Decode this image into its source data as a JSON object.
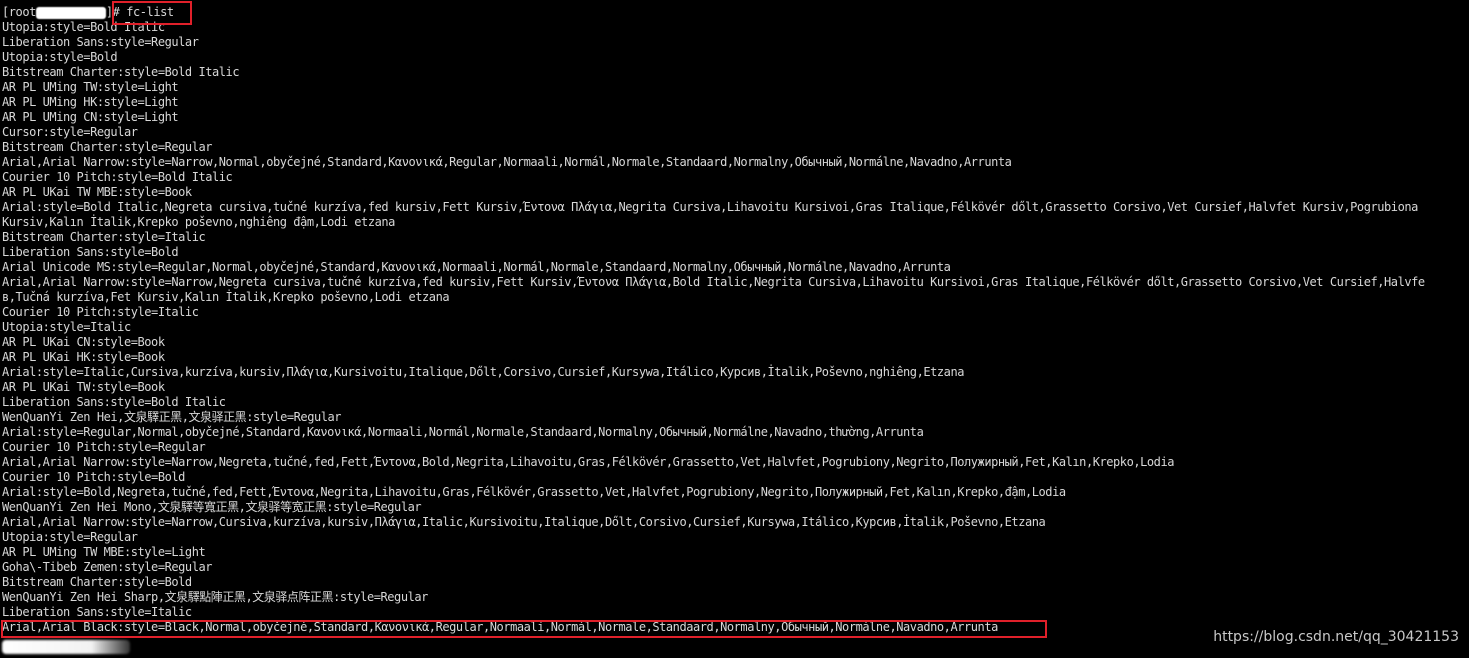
{
  "terminal": {
    "prompt_prefix": "[root",
    "prompt_suffix": "]#",
    "command": "fc-list",
    "lines": [
      "Utopia:style=Bold Italic",
      "Liberation Sans:style=Regular",
      "Utopia:style=Bold",
      "Bitstream Charter:style=Bold Italic",
      "AR PL UMing TW:style=Light",
      "AR PL UMing HK:style=Light",
      "AR PL UMing CN:style=Light",
      "Cursor:style=Regular",
      "Bitstream Charter:style=Regular",
      "Arial,Arial Narrow:style=Narrow,Normal,obyčejné,Standard,Κανονικά,Regular,Normaali,Normál,Normale,Standaard,Normalny,Обычный,Normálne,Navadno,Arrunta",
      "Courier 10 Pitch:style=Bold Italic",
      "AR PL UKai TW MBE:style=Book",
      "Arial:style=Bold Italic,Negreta cursiva,tučné kurzíva,fed kursiv,Fett Kursiv,Έντονα Πλάγια,Negrita Cursiva,Lihavoitu Kursivoi,Gras Italique,Félkövér dőlt,Grassetto Corsivo,Vet Cursief,Halvfet Kursiv,Pogrubiona",
      "Kursiv,Kalın İtalik,Krepko poševno,nghiêng đậm,Lodi etzana",
      "Bitstream Charter:style=Italic",
      "Liberation Sans:style=Bold",
      "Arial Unicode MS:style=Regular,Normal,obyčejné,Standard,Κανονικά,Normaali,Normál,Normale,Standaard,Normalny,Обычный,Normálne,Navadno,Arrunta",
      "Arial,Arial Narrow:style=Narrow,Negreta cursiva,tučné kurzíva,fed kursiv,Fett Kursiv,Έντονα Πλάγια,Bold Italic,Negrita Cursiva,Lihavoitu Kursivoi,Gras Italique,Félkövér dőlt,Grassetto Corsivo,Vet Cursief,Halvfe",
      "в,Tučná kurzíva,Fet Kursiv,Kalın İtalik,Krepko poševno,Lodi etzana",
      "Courier 10 Pitch:style=Italic",
      "Utopia:style=Italic",
      "AR PL UKai CN:style=Book",
      "AR PL UKai HK:style=Book",
      "Arial:style=Italic,Cursiva,kurzíva,kursiv,Πλάγια,Kursivoitu,Italique,Dőlt,Corsivo,Cursief,Kursywa,Itálico,Курсив,İtalik,Poševno,nghiêng,Etzana",
      "AR PL UKai TW:style=Book",
      "Liberation Sans:style=Bold Italic",
      "WenQuanYi Zen Hei,文泉驛正黑,文泉驿正黑:style=Regular",
      "Arial:style=Regular,Normal,obyčejné,Standard,Κανονικά,Normaali,Normál,Normale,Standaard,Normalny,Обычный,Normálne,Navadno,thường,Arrunta",
      "Courier 10 Pitch:style=Regular",
      "Arial,Arial Narrow:style=Narrow,Negreta,tučné,fed,Fett,Έντονα,Bold,Negrita,Lihavoitu,Gras,Félkövér,Grassetto,Vet,Halvfet,Pogrubiony,Negrito,Полужирный,Fet,Kalın,Krepko,Lodia",
      "Courier 10 Pitch:style=Bold",
      "Arial:style=Bold,Negreta,tučné,fed,Fett,Έντονα,Negrita,Lihavoitu,Gras,Félkövér,Grassetto,Vet,Halvfet,Pogrubiony,Negrito,Полужирный,Fet,Kalın,Krepko,đậm,Lodia",
      "WenQuanYi Zen Hei Mono,文泉驛等寬正黑,文泉驿等宽正黑:style=Regular",
      "Arial,Arial Narrow:style=Narrow,Cursiva,kurzíva,kursiv,Πλάγια,Italic,Kursivoitu,Italique,Dőlt,Corsivo,Cursief,Kursywa,Itálico,Курсив,İtalik,Poševno,Etzana",
      "Utopia:style=Regular",
      "AR PL UMing TW MBE:style=Light",
      "Goha\\-Tibeb Zemen:style=Regular",
      "Bitstream Charter:style=Bold",
      "WenQuanYi Zen Hei Sharp,文泉驛點陣正黑,文泉驿点阵正黑:style=Regular",
      "Liberation Sans:style=Italic",
      "Arial,Arial Black:style=Black,Normal,obyčejné,Standard,Κανονικά,Regular,Normaali,Normál,Normale,Standaard,Normalny,Обычный,Normálne,Navadno,Arrunta"
    ]
  },
  "watermark": "https://blog.csdn.net/qq_30421153",
  "colors": {
    "background": "#000000",
    "text": "#d8d8d8",
    "highlight": "#e0202a"
  }
}
